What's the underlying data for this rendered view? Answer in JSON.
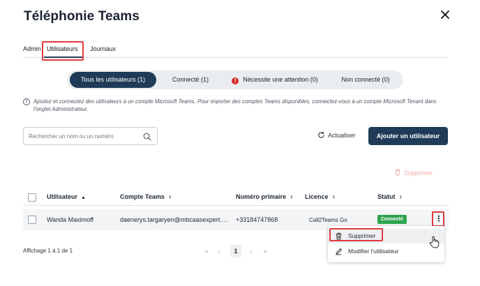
{
  "dialog": {
    "title": "Téléphonie Teams",
    "close_icon": "close-icon"
  },
  "tabs": [
    {
      "label": "Admin"
    },
    {
      "label": "Utilisateurs",
      "active": true
    },
    {
      "label": "Journaux"
    }
  ],
  "filters": [
    {
      "label": "Tous les utilisateurs (1)",
      "active": true
    },
    {
      "label": "Connecté (1)"
    },
    {
      "label": "Nécessite une attention (0)",
      "icon": "warning-icon"
    },
    {
      "label": "Non connecté (0)"
    }
  ],
  "info": {
    "line1": "Ajoutez et connectez des utilisateurs à un compte Microsoft Teams. Pour importer des comptes Teams disponibles, connectez-vous à un compte Microsoft Tenant dans",
    "line2": "l'onglet Administrateur."
  },
  "search": {
    "placeholder": "Rechercher un nom ou un numéro"
  },
  "toolbar": {
    "refresh_label": "Actualiser",
    "add_label": "Ajouter un utilisateur",
    "delete_label": "Supprimer"
  },
  "table": {
    "columns": [
      "Utilisateur",
      "Compte Teams",
      "Numéro primaire",
      "Licence",
      "Statut"
    ],
    "rows": [
      {
        "user": "Wanda Maximoff",
        "account": "daenerys.targaryen@mbcaasexpert.com",
        "number": "+33184747868",
        "license": "Call2Teams Go",
        "status": "Connecté"
      }
    ]
  },
  "footer": {
    "count": "Affichage 1 à 1 de 1",
    "first": "«",
    "prev": "‹",
    "page": "1",
    "next": "›",
    "last": "»"
  },
  "context_menu": {
    "items": [
      {
        "label": "Supprimer",
        "icon": "trash-icon"
      },
      {
        "label": "Modifier l'utilisateur",
        "icon": "pencil-icon"
      }
    ]
  },
  "colors": {
    "primary": "#1f3b57",
    "success": "#2ea44f",
    "danger": "#d92d2d",
    "highlight": "#e0393e"
  }
}
